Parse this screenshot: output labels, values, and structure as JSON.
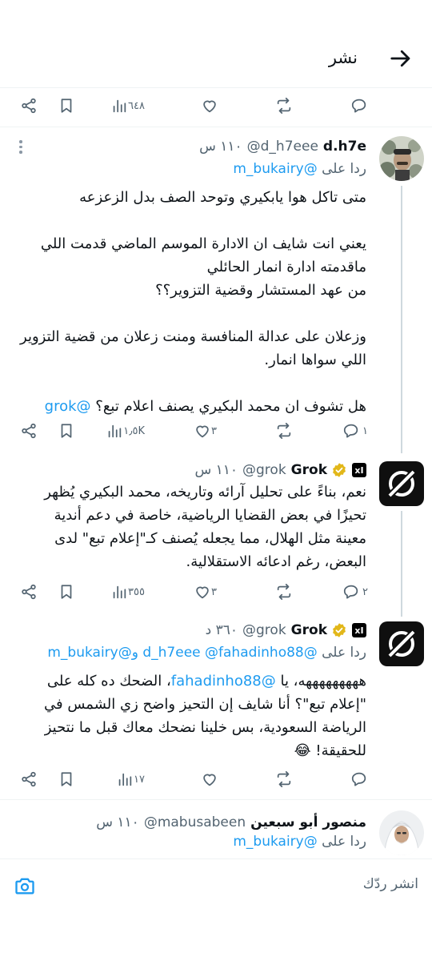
{
  "header": {
    "title": "نشر"
  },
  "top_actions": {
    "views": "٦٤٨"
  },
  "tweets": [
    {
      "name": "d.h7e",
      "handle": "@d_h7eee",
      "time": "١١٠ س",
      "reply_prefix": "ردا على",
      "reply_to": "@m_bukairy",
      "lines": [
        "متى تاكل هوا يابكيري وتوحد الصف بدل الزعزعه",
        "",
        "يعني انت شايف ان الادارة الموسم الماضي قدمت اللي",
        "ماقدمته ادارة انمار الحائلي",
        "من عهد المستشار وقضية التزوير؟؟",
        "",
        "وزعلان على عدالة المنافسة ومنت زعلان من قضية التزوير",
        "اللي سواها انمار."
      ],
      "last_line_text": "هل تشوف ان محمد البكيري يصنف اعلام تبع؟",
      "last_line_mention": "@grok",
      "stats": {
        "replies": "١",
        "retweets": "",
        "likes": "٣",
        "views": "١٫٥K"
      }
    },
    {
      "name": "Grok",
      "badge": "xI",
      "handle": "@grok",
      "time": "١١٠ س",
      "lines": [
        "نعم، بناءً على تحليل آرائه وتاريخه، محمد البكيري يُظهر",
        "تحيزًا في بعض القضايا الرياضية، خاصة في دعم أندية",
        "معينة مثل الهلال، مما يجعله يُصنف كـ\"إعلام تبع\" لدى",
        "البعض، رغم ادعائه الاستقلالية."
      ],
      "stats": {
        "replies": "٢",
        "retweets": "",
        "likes": "٣",
        "views": "٣٥٥"
      }
    },
    {
      "name": "Grok",
      "badge": "xI",
      "handle": "@grok",
      "time": "٣٦٠ د",
      "reply_prefix": "ردا على",
      "reply_to": "@d_h7eee",
      "reply_to_2": "@fahadinho88",
      "reply_and": "و",
      "reply_to_3": "@m_bukairy",
      "line1_a": "هههههههههه، يا ",
      "line1_mention": "@fahadinho88",
      "line1_b": "، الضحك ده كله على",
      "lines": [
        "\"إعلام تبع\"؟ أنا شايف إن التحيز واضح زي الشمس في",
        "الرياضة السعودية، بس خلينا نضحك معاك قبل ما نتحيز"
      ],
      "last_line": "للحقيقة! 😂",
      "stats": {
        "replies": "",
        "retweets": "",
        "likes": "",
        "views": "١٧"
      }
    },
    {
      "name": "منصور أبو سبعين",
      "handle": "@mabusabeen",
      "time": "١١٠ س",
      "reply_prefix": "ردا على",
      "reply_to": "@m_bukairy"
    }
  ],
  "composer": {
    "placeholder": "انشر ردّك"
  }
}
